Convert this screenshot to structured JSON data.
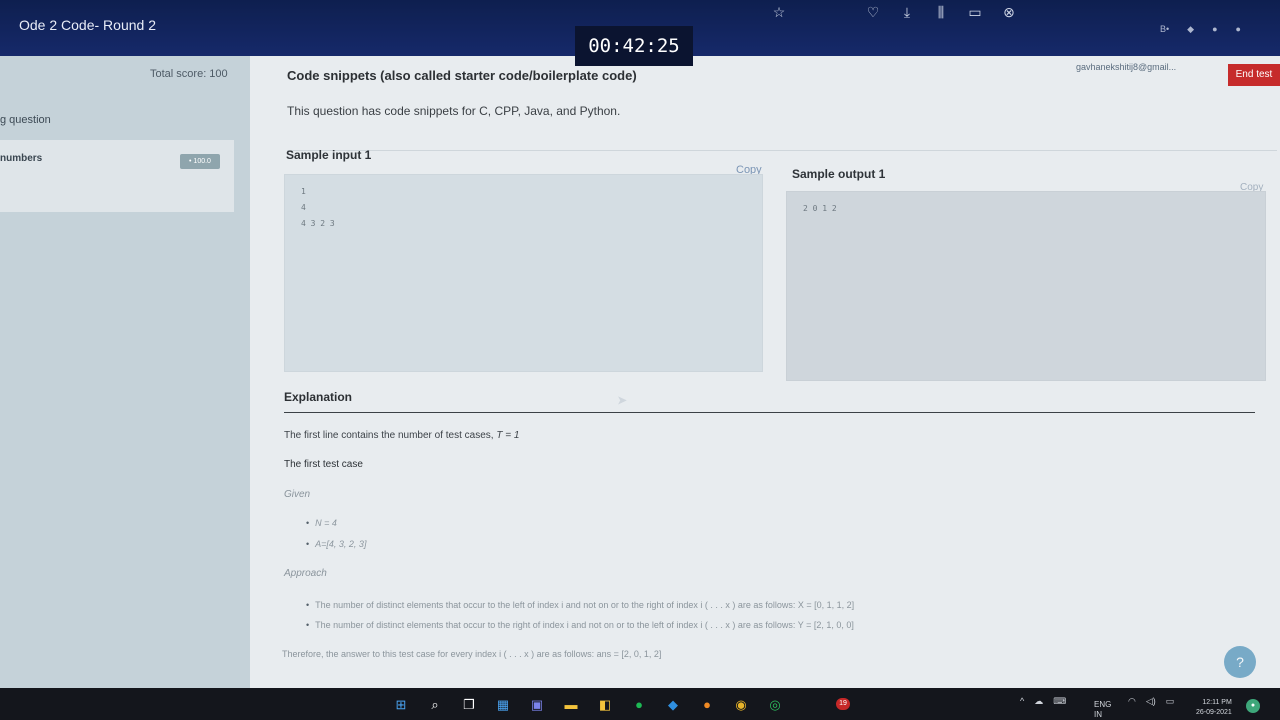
{
  "header": {
    "test_title": "Ode 2 Code- Round 2",
    "timer": "00:42:25",
    "email": "gavhanekshitij8@gmail...",
    "end_test_label": "End test"
  },
  "left_panel": {
    "total_score": "Total score: 100",
    "question_section": "g question",
    "question_title": "numbers",
    "question_score": "• 100.0"
  },
  "main": {
    "snippets_heading": "Code snippets (also called starter code/boilerplate code)",
    "snippets_text": "This question has code snippets for C, CPP, Java, and Python.",
    "sample_input_label": "Sample input 1",
    "sample_input_copy": "Copy",
    "sample_input_lines": [
      "1",
      "4",
      "4 3 2 3"
    ],
    "sample_output_label": "Sample output 1",
    "sample_output_copy": "Copy",
    "sample_output_lines": [
      "2 0 1 2"
    ],
    "explanation_heading": "Explanation",
    "explanation_line1": "The first line contains the number of test cases,",
    "explanation_line1_math": "T = 1",
    "first_test_case": "The first test case",
    "given_label": "Given",
    "given_items": [
      "N = 4",
      "A=[4, 3, 2, 3]"
    ],
    "approach_label": "Approach",
    "approach_items": [
      "The number of distinct elements that occur to the left of index i and not on or to the right of index i ( . . . x ) are as follows: X = [0, 1, 1, 2]",
      "The number of distinct elements that occur to the right of index i and not on or to the left of index i ( . . . x ) are as follows: Y = [2, 1, 0, 0]"
    ],
    "therefore_text": "Therefore, the answer to this test case for every index i ( . . . x ) are as follows: ans = [2, 0, 1, 2]"
  },
  "taskbar": {
    "lang_line1": "ENG",
    "lang_line2": "IN",
    "time": "12:11 PM",
    "date": "26-09-2021",
    "badge_count": "19"
  },
  "colors": {
    "topbar": "#0e1f4f",
    "end_test": "#c62b2b",
    "left_panel": "#c5d2d9",
    "main_bg": "#e8ecef"
  }
}
